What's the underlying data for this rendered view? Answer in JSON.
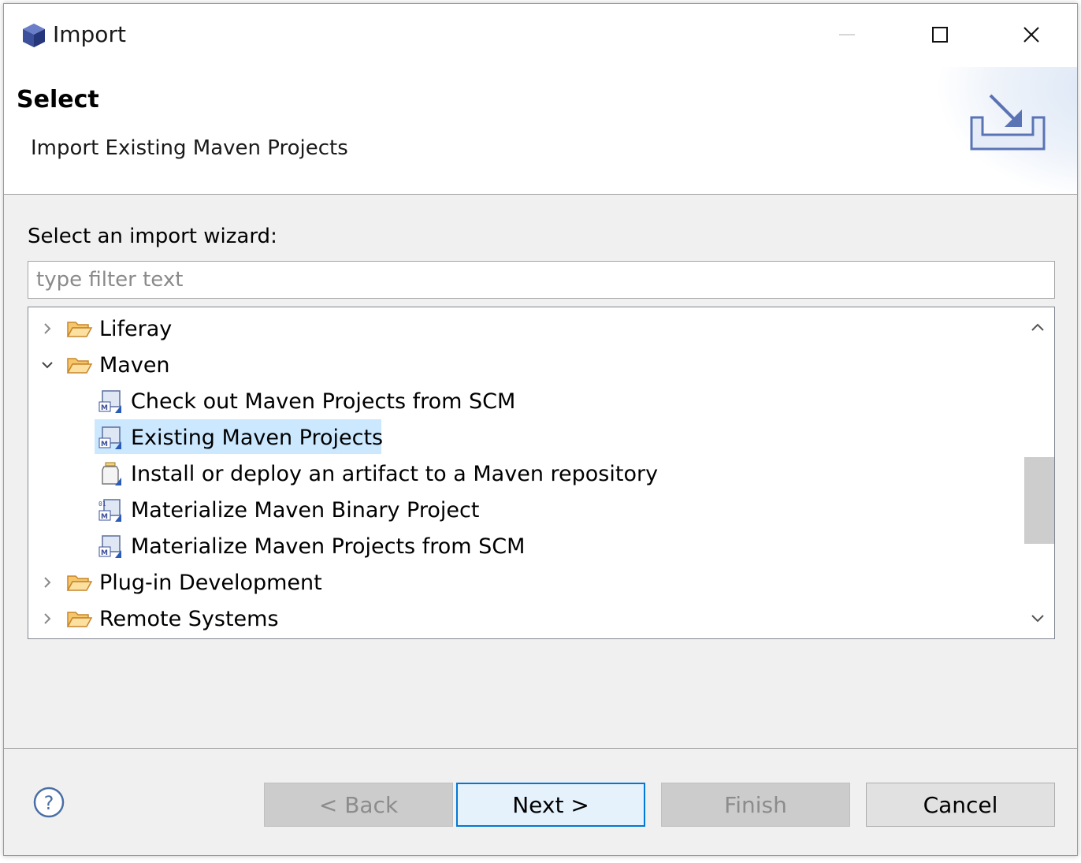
{
  "window": {
    "title": "Import",
    "minimize_icon": "minimize-icon",
    "maximize_icon": "maximize-icon",
    "close_icon": "close-icon"
  },
  "banner": {
    "title": "Select",
    "description": "Import Existing Maven Projects"
  },
  "wizard": {
    "label": "Select an import wizard:",
    "filter_placeholder": "type filter text",
    "filter_value": ""
  },
  "tree": {
    "items": [
      {
        "label": "Liferay",
        "expanded": false
      },
      {
        "label": "Maven",
        "expanded": true
      },
      {
        "label": "Check out Maven Projects from SCM"
      },
      {
        "label": "Existing Maven Projects",
        "selected": true
      },
      {
        "label": "Install or deploy an artifact to a Maven repository"
      },
      {
        "label": "Materialize Maven Binary Project"
      },
      {
        "label": "Materialize Maven Projects from SCM"
      },
      {
        "label": "Plug-in Development",
        "expanded": false
      },
      {
        "label": "Remote Systems",
        "expanded": false
      }
    ]
  },
  "buttons": {
    "back": "< Back",
    "next": "Next >",
    "finish": "Finish",
    "cancel": "Cancel"
  },
  "colors": {
    "selection": "#cce8ff",
    "default_button_border": "#0078d7",
    "folder": "#e8a33d"
  }
}
